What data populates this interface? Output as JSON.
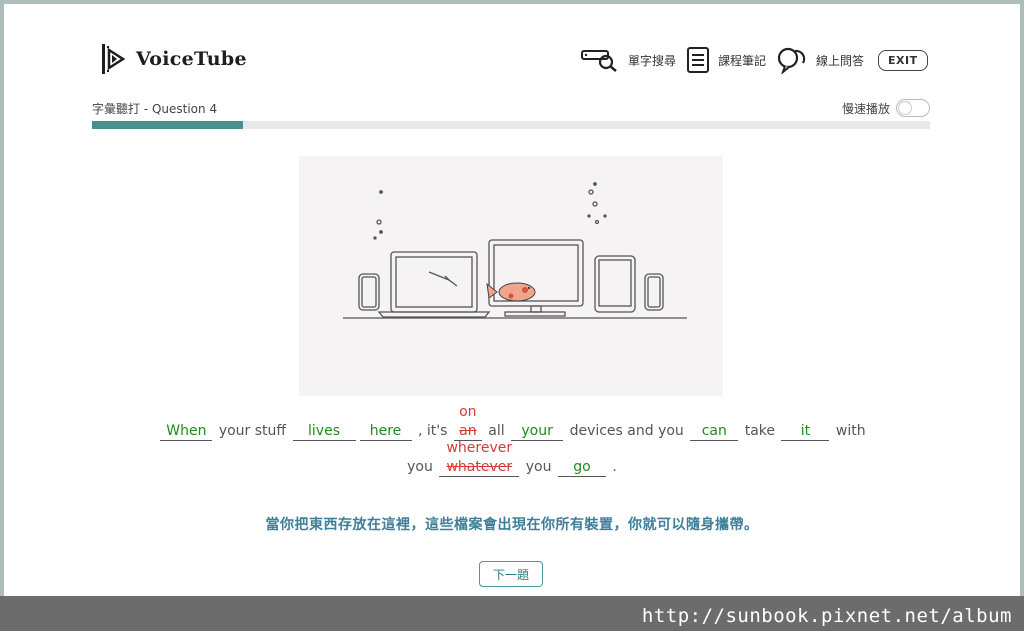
{
  "header": {
    "logo_text": "VoiceTube",
    "nav": [
      {
        "label": "單字搜尋",
        "icon": "word-search-icon"
      },
      {
        "label": "課程筆記",
        "icon": "notes-icon"
      },
      {
        "label": "線上問答",
        "icon": "chat-icon"
      }
    ],
    "exit_label": "EXIT"
  },
  "quiz": {
    "question_label": "字彙聽打 - Question 4",
    "slow_play_label": "慢速播放",
    "slow_play_on": false,
    "progress_fraction": 0.18
  },
  "sentence": {
    "line1": [
      {
        "type": "blank",
        "text": "When"
      },
      {
        "type": "text",
        "text": "your stuff"
      },
      {
        "type": "blank",
        "text": "lives"
      },
      {
        "type": "blank",
        "text": "here"
      },
      {
        "type": "text",
        "text": ", it's"
      },
      {
        "type": "wrong",
        "text": "an",
        "correct": "on"
      },
      {
        "type": "text",
        "text": "all"
      },
      {
        "type": "blank",
        "text": "your"
      },
      {
        "type": "text",
        "text": "devices and you"
      },
      {
        "type": "blank",
        "text": "can"
      },
      {
        "type": "text",
        "text": "take"
      },
      {
        "type": "blank",
        "text": "it"
      },
      {
        "type": "text",
        "text": "with"
      }
    ],
    "line2": [
      {
        "type": "text",
        "text": "you"
      },
      {
        "type": "wrong",
        "text": "whatever",
        "correct": "wherever"
      },
      {
        "type": "text",
        "text": "you"
      },
      {
        "type": "blank",
        "text": "go"
      },
      {
        "type": "text",
        "text": "."
      }
    ]
  },
  "translation": "當你把東西存放在這裡，這些檔案會出現在你所有裝置，你就可以隨身攜帶。",
  "next_button_label": "下一題",
  "watermark": "http://sunbook.pixnet.net/album",
  "colors": {
    "accent": "#4a8e8e",
    "correct": "#1e8a1e",
    "wrong": "#d43a3a",
    "translation": "#3d7f99"
  }
}
